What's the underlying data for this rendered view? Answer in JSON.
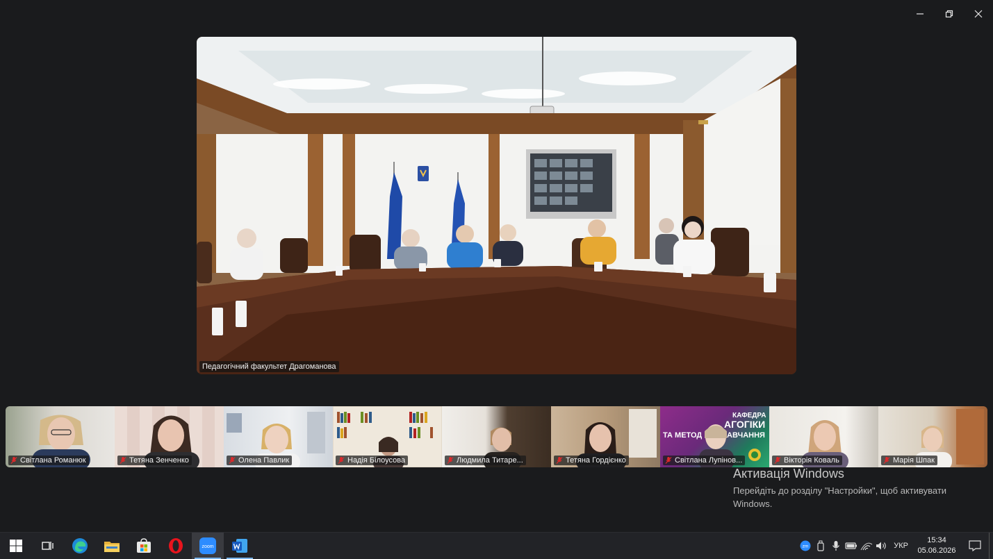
{
  "window": {
    "controls": [
      "minimize",
      "restore",
      "close"
    ]
  },
  "main_video": {
    "participant_name": "Педагогічний факультет Драгоманова"
  },
  "gallery": [
    {
      "name": "Світлана Романюк",
      "muted": true,
      "bg": "#c8c4b8"
    },
    {
      "name": "Тетяна Зенченко",
      "muted": true,
      "bg": "#e9d8d0"
    },
    {
      "name": "Олена Павлик",
      "muted": true,
      "bg": "#d7dbe0"
    },
    {
      "name": "Надія Білоусова",
      "muted": true,
      "bg": "#e6e0d4"
    },
    {
      "name": "Людмила Титаре...",
      "muted": true,
      "bg": "#5b4b3c"
    },
    {
      "name": "Тетяна Гордієнко",
      "muted": true,
      "bg": "#b9a48e"
    },
    {
      "name": "Світлана Лупінов...",
      "muted": true,
      "bg": "#7a2c7f"
    },
    {
      "name": "Вікторія Коваль",
      "muted": true,
      "bg": "#e6e2dc"
    },
    {
      "name": "Марія Шпак",
      "muted": true,
      "bg": "#c79f70"
    }
  ],
  "tile_texts": {
    "kafedra": "КАФЕДРА",
    "pedagogiky": "АГОГІКИ",
    "ta_metod": "ТА МЕТОД",
    "navchannia": "АВЧАННЯ"
  },
  "watermark": {
    "title": "Активація Windows",
    "text": "Перейдіть до розділу \"Настройки\", щоб активувати Windows."
  },
  "taskbar": {
    "apps": [
      "windows-start",
      "task-view",
      "edge",
      "file-explorer",
      "microsoft-store",
      "opera",
      "zoom",
      "word"
    ],
    "language": "УКР",
    "time": "15:34",
    "date": "05.06.2026"
  },
  "colors": {
    "background": "#1a1b1d",
    "taskbar": "#222327",
    "mute_red": "#e0292b",
    "accent": "#7ab4ea"
  }
}
